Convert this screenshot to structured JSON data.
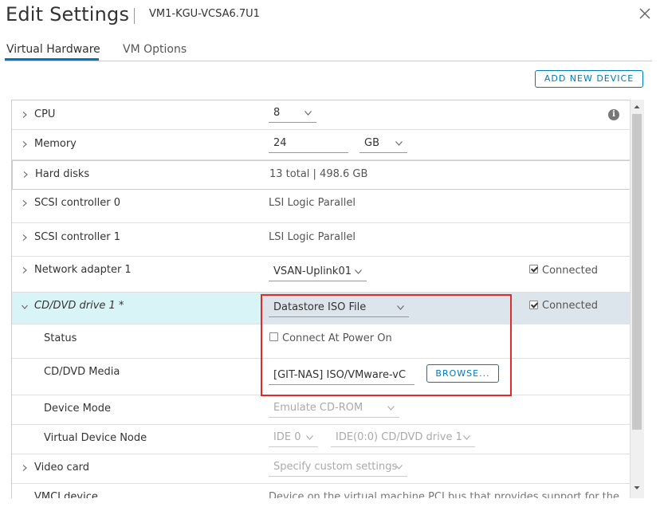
{
  "header": {
    "title": "Edit Settings",
    "vm_name": "VM1-KGU-VCSA6.7U1"
  },
  "tabs": [
    {
      "label": "Virtual Hardware",
      "active": true
    },
    {
      "label": "VM Options",
      "active": false
    }
  ],
  "toolbar": {
    "add_device_label": "ADD NEW DEVICE"
  },
  "hardware": {
    "cpu": {
      "label": "CPU",
      "value": "8"
    },
    "memory": {
      "label": "Memory",
      "value": "24",
      "unit": "GB"
    },
    "hard_disks": {
      "label": "Hard disks",
      "value": "13 total | 498.6 GB"
    },
    "scsi0": {
      "label": "SCSI controller 0",
      "value": "LSI Logic Parallel"
    },
    "scsi1": {
      "label": "SCSI controller 1",
      "value": "LSI Logic Parallel"
    },
    "network": {
      "label": "Network adapter 1",
      "value": "VSAN-Uplink01",
      "connected_label": "Connected",
      "connected": true
    },
    "cdrom": {
      "label": "CD/DVD drive 1 *",
      "value": "Datastore ISO File",
      "connected_label": "Connected",
      "connected": true,
      "status": {
        "label": "Status",
        "power_on_label": "Connect At Power On",
        "power_on": false
      },
      "media": {
        "label": "CD/DVD Media",
        "value": "[GIT-NAS] ISO/VMware-vC",
        "browse_label": "BROWSE..."
      },
      "device_mode": {
        "label": "Device Mode",
        "value": "Emulate CD-ROM"
      },
      "vnode": {
        "label": "Virtual Device Node",
        "controller": "IDE 0",
        "node": "IDE(0:0) CD/DVD drive 1"
      }
    },
    "video": {
      "label": "Video card",
      "value": "Specify custom settings"
    },
    "vmci": {
      "label": "VMCI device",
      "value": "Device on the virtual machine PCI bus that provides support for the"
    }
  },
  "colors": {
    "accent": "#0079b8",
    "highlight_row": "#d9f4f6",
    "selected_field": "#dde5ec",
    "callout": "#e12b2b"
  }
}
